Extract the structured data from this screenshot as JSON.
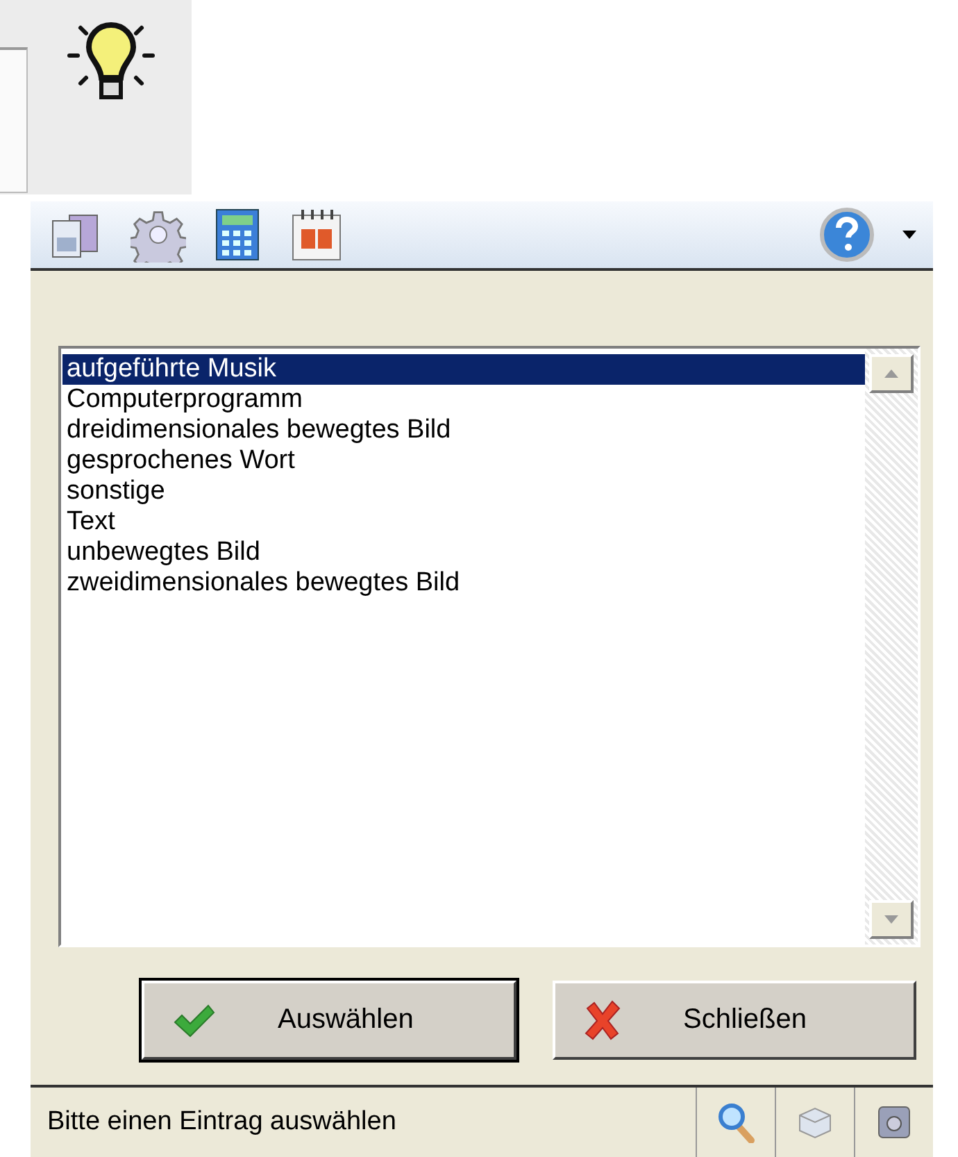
{
  "list": {
    "items": [
      {
        "label": "aufgeführte Musik",
        "selected": true
      },
      {
        "label": "Computerprogramm",
        "selected": false
      },
      {
        "label": "dreidimensionales bewegtes Bild",
        "selected": false
      },
      {
        "label": "gesprochenes Wort",
        "selected": false
      },
      {
        "label": "sonstige",
        "selected": false
      },
      {
        "label": "Text",
        "selected": false
      },
      {
        "label": "unbewegtes Bild",
        "selected": false
      },
      {
        "label": "zweidimensionales bewegtes Bild",
        "selected": false
      }
    ]
  },
  "buttons": [
    {
      "label": "Auswählen",
      "kind": "ok",
      "default": true
    },
    {
      "label": "Schließen",
      "kind": "close",
      "default": false
    }
  ],
  "status_bar": {
    "text": "Bitte einen Eintrag auswählen"
  }
}
